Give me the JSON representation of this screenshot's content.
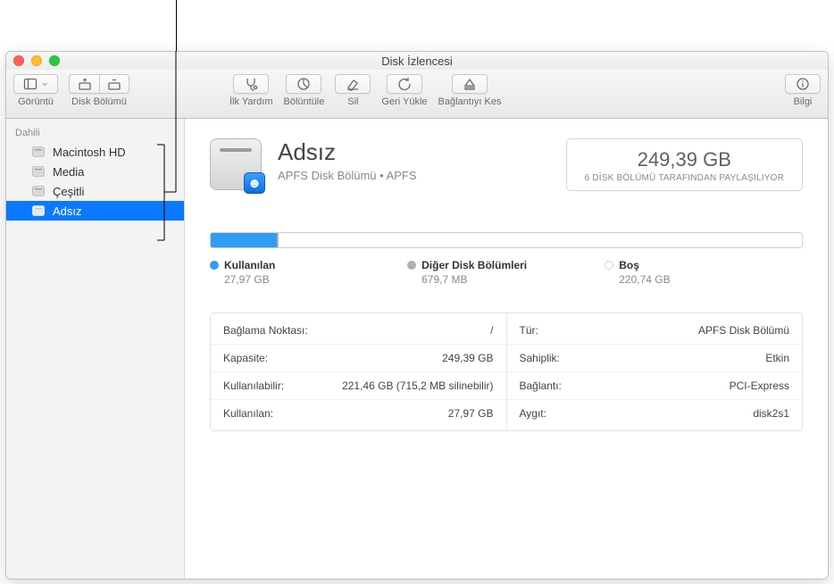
{
  "window": {
    "title": "Disk İzlencesi"
  },
  "toolbar": {
    "view_label": "Görüntü",
    "partition_label": "Disk Bölümü",
    "firstaid_label": "İlk Yardım",
    "partition2_label": "Bölüntüle",
    "erase_label": "Sil",
    "restore_label": "Geri Yükle",
    "unmount_label": "Bağlantıyı Kes",
    "info_label": "Bilgi"
  },
  "sidebar": {
    "section": "Dahili",
    "items": [
      {
        "label": "Macintosh HD"
      },
      {
        "label": "Media"
      },
      {
        "label": "Çeşitli"
      },
      {
        "label": "Adsız"
      }
    ],
    "selected_index": 3
  },
  "volume": {
    "name": "Adsız",
    "subtitle": "APFS Disk Bölümü • APFS",
    "capacity": "249,39 GB",
    "capacity_sub": "6 DİSK BÖLÜMÜ TARAFINDAN PAYLAŞILIYOR"
  },
  "usage": {
    "used_pct": 11.2,
    "other_pct": 0.27,
    "legend": {
      "used_label": "Kullanılan",
      "used_value": "27,97 GB",
      "other_label": "Diğer Disk Bölümleri",
      "other_value": "679,7 MB",
      "free_label": "Boş",
      "free_value": "220,74 GB"
    }
  },
  "details": {
    "left": [
      {
        "k": "Bağlama Noktası:",
        "v": "/"
      },
      {
        "k": "Kapasite:",
        "v": "249,39 GB"
      },
      {
        "k": "Kullanılabilir:",
        "v": "221,46 GB (715,2 MB silinebilir)"
      },
      {
        "k": "Kullanılan:",
        "v": "27,97 GB"
      }
    ],
    "right": [
      {
        "k": "Tür:",
        "v": "APFS Disk Bölümü"
      },
      {
        "k": "Sahiplik:",
        "v": "Etkin"
      },
      {
        "k": "Bağlantı:",
        "v": "PCI-Express"
      },
      {
        "k": "Aygıt:",
        "v": "disk2s1"
      }
    ]
  },
  "chart_data": {
    "type": "bar",
    "title": "",
    "categories": [
      "Kullanılan",
      "Diğer Disk Bölümleri",
      "Boş"
    ],
    "values_gb": [
      27.97,
      0.6797,
      220.74
    ],
    "total_gb": 249.39,
    "xlabel": "",
    "ylabel": "GB",
    "ylim": [
      0,
      249.39
    ]
  }
}
